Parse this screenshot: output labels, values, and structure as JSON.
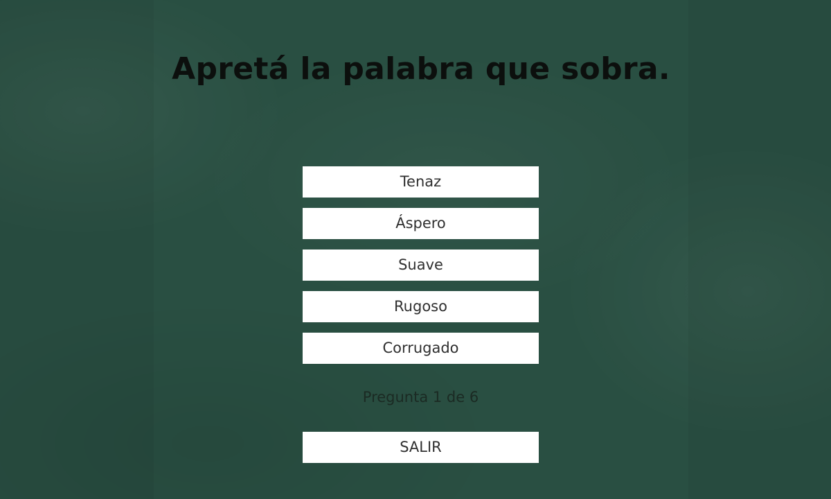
{
  "question": {
    "prompt": "Apretá la palabra que sobra."
  },
  "options": [
    {
      "label": "Tenaz"
    },
    {
      "label": "Áspero"
    },
    {
      "label": "Suave"
    },
    {
      "label": "Rugoso"
    },
    {
      "label": "Corrugado"
    }
  ],
  "progress": {
    "text": "Pregunta 1 de 6"
  },
  "exit": {
    "label": "SALIR"
  },
  "colors": {
    "background": "#294f42",
    "button_background": "#ffffff",
    "button_text": "#2f2f2f",
    "title_text": "#0c0f0d"
  }
}
